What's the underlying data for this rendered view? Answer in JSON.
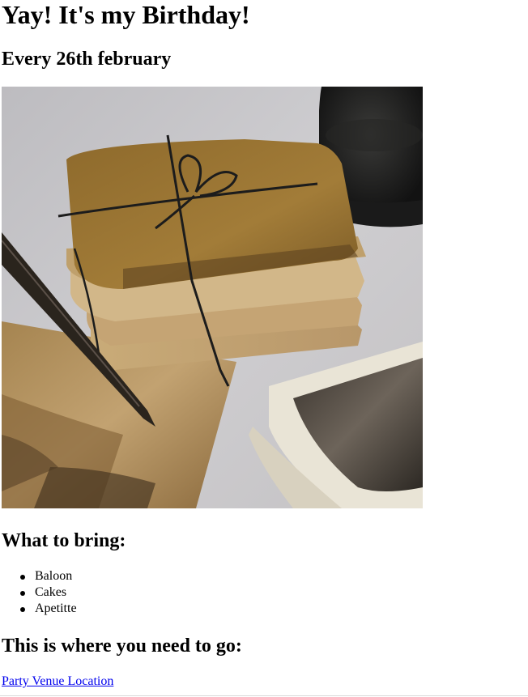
{
  "page": {
    "title": "Yay! It's my Birthday!",
    "subtitle": "Every 26th february"
  },
  "image": {
    "alt": ""
  },
  "bring": {
    "heading": "What to bring:",
    "items": [
      "Baloon",
      "Cakes",
      "Apetitte"
    ]
  },
  "location": {
    "heading": "This is where you need to go:",
    "link_label": "Party Venue Location"
  },
  "colors": {
    "link": "#0000ee",
    "text": "#000000",
    "background": "#ffffff"
  }
}
